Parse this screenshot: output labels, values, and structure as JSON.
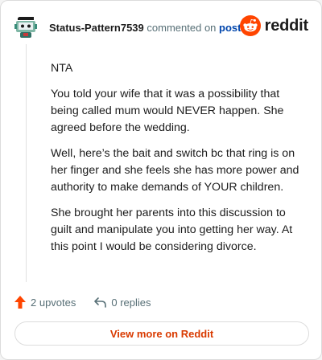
{
  "comment": {
    "username": "Status-Pattern7539",
    "commented_text": "commented on",
    "post_link": "post",
    "paragraphs": [
      "NTA",
      "You told your wife that it was a possibility that being called mum would NEVER happen. She agreed before the wedding.",
      "Well, here’s the bait and switch bc that ring is on her finger and she feels she has more power and authority to make demands of YOUR children.",
      "She brought her parents into this discussion to guilt and manipulate you into getting her way. At this point I would be considering divorce."
    ]
  },
  "brand": {
    "name": "reddit",
    "color": "#ff4500"
  },
  "actions": {
    "upvotes": "2 upvotes",
    "replies": "0 replies",
    "upvote_color": "#ff4500"
  },
  "footer": {
    "view_more": "View more on Reddit"
  },
  "icons": {
    "avatar": "snoo-avatar-icon",
    "logo": "reddit-alien-icon",
    "upvote": "upvote-arrow-icon",
    "reply": "reply-arrow-icon"
  }
}
